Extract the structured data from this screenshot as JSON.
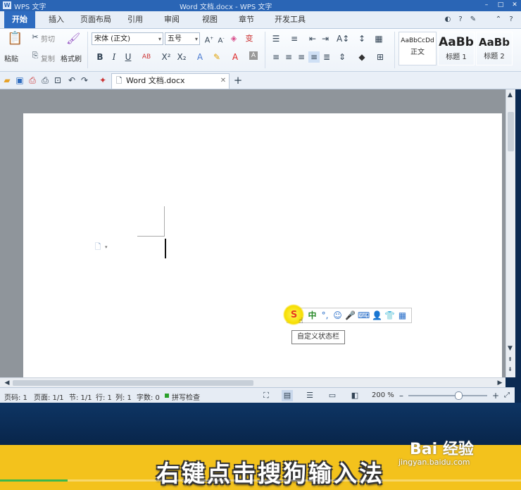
{
  "window": {
    "title": "Word 文档.docx - WPS 文字",
    "logo": "W",
    "app_name": "WPS 文字"
  },
  "menu_tabs": [
    "开始",
    "插入",
    "页面布局",
    "引用",
    "审阅",
    "视图",
    "章节",
    "开发工具"
  ],
  "ribbon": {
    "paste": "粘贴",
    "cut": "剪切",
    "copy": "复制",
    "format_painter": "格式刷",
    "font_name": "宋体 (正文)",
    "font_size": "五号",
    "styles": [
      {
        "preview": "AaBbCcDd",
        "name": "正文"
      },
      {
        "preview": "AaBb",
        "name": "标题 1"
      },
      {
        "preview": "AaBb",
        "name": "标题 2"
      }
    ]
  },
  "document_tab": {
    "name": "Word 文档.docx"
  },
  "ime_tooltip": "自定义状态栏",
  "ime_mode": "中",
  "status": {
    "page_code": "页码: 1",
    "page": "页面: 1/1",
    "section": "节: 1/1",
    "row": "行: 1",
    "col": "列: 1",
    "word_count": "字数: 0",
    "spell_check": "拼写检查",
    "zoom": "200 %"
  },
  "caption": "右键点击搜狗输入法",
  "watermark": {
    "brand": "Bai 经验",
    "url": "jingyan.baidu.com"
  },
  "colors": {
    "accent": "#2e6cc0",
    "caption_bg": "#f3c21c",
    "ime_logo": "#e63a1c"
  }
}
